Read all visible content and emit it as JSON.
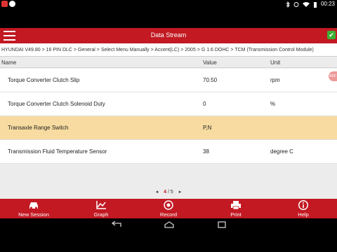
{
  "statusbar": {
    "time": "00:23"
  },
  "header": {
    "title": "Data Stream"
  },
  "breadcrumb": "HYUNDAI V49.80 > 16 PIN DLC > General > Select Menu Manually > Accent(LC) > 2005 > G 1.6 DOHC > TCM (Transmission Control Module)",
  "table": {
    "columns": {
      "name": "Name",
      "value": "Value",
      "unit": "Unit"
    },
    "rows": [
      {
        "name": "Torque Converter Clutch Slip",
        "value": "70.50",
        "unit": "rpm"
      },
      {
        "name": "Torque Converter Clutch Solenoid Duty",
        "value": "0",
        "unit": "%"
      },
      {
        "name": "Transaxle Range Switch",
        "value": "P,N",
        "unit": ""
      },
      {
        "name": "Transmission Fluid Temperature Sensor",
        "value": "38",
        "unit": "degree C"
      }
    ],
    "selected_row": 2
  },
  "pager": {
    "current": "4",
    "total": "/ 5"
  },
  "toolbar": {
    "new_session": "New Session",
    "graph": "Graph",
    "record": "Record",
    "print": "Print",
    "help": "Help"
  },
  "colors": {
    "accent": "#c21922",
    "selected_row": "#f7dba0",
    "confirm": "#3cb034"
  }
}
